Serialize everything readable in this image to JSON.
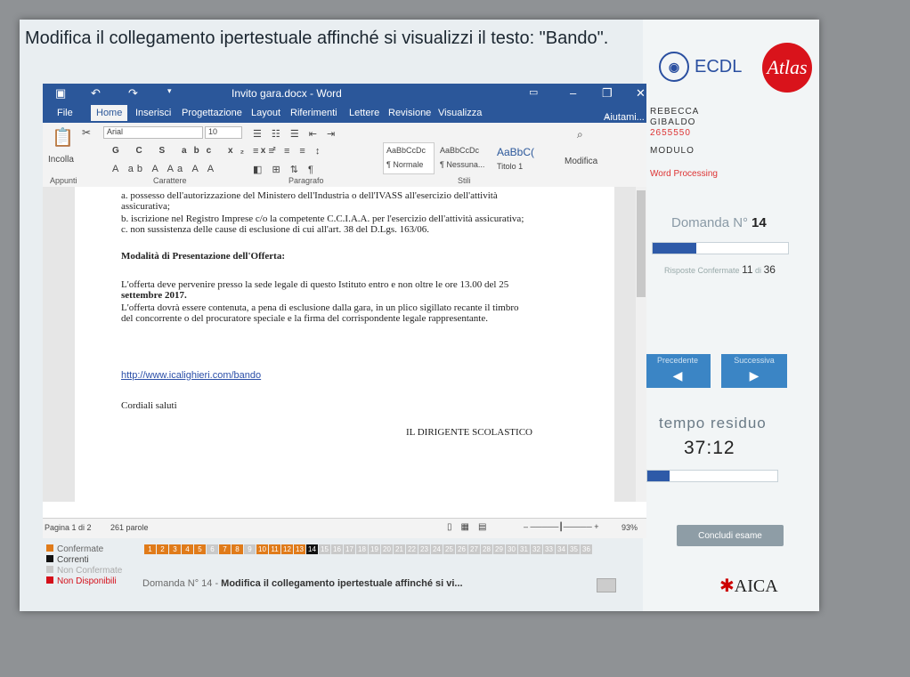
{
  "question_text": "Modifica il collegamento ipertestuale affinché si visualizzi il testo: \"Bando\".",
  "branding": {
    "ecdl": "ECDL",
    "atlas": "Atlas",
    "aica": "AICA"
  },
  "candidate": {
    "name": "REBECCA",
    "surname": "GIBALDO",
    "code": "2655550",
    "module_label": "MODULO",
    "module": "Word Processing"
  },
  "domanda": {
    "label": "Domanda N°",
    "number": "14",
    "progress": 0.32
  },
  "risposte": {
    "label": "Risposte Confermate",
    "count": "11",
    "of": "di",
    "total": "36"
  },
  "nav": {
    "prev": "Precedente",
    "next": "Successiva"
  },
  "timer": {
    "label": "tempo residuo",
    "value": "37:12",
    "progress": 0.17
  },
  "conclude": "Concludi esame",
  "word": {
    "title": "Invito gara.docx - Word",
    "menu": [
      "File",
      "Home",
      "Inserisci",
      "Progettazione",
      "Layout",
      "Riferimenti",
      "Lettere",
      "Revisione",
      "Visualizza"
    ],
    "help": "Aiutami...",
    "font": "Arial",
    "size": "10",
    "paste": "Incolla",
    "groups": [
      "Appunti",
      "Carattere",
      "Paragrafo",
      "Stili"
    ],
    "styles": [
      {
        "preview": "AaBbCcDc",
        "name": "¶ Normale"
      },
      {
        "preview": "AaBbCcDc",
        "name": "¶ Nessuna..."
      },
      {
        "preview": "AaBbC(",
        "name": "Titolo 1"
      }
    ],
    "modify": "Modifica",
    "status": {
      "page": "Pagina 1 di 2",
      "words": "261 parole",
      "zoom": "93%"
    }
  },
  "doc": {
    "lines": [
      "a. possesso dell'autorizzazione del Ministero dell'Industria o dell'IVASS all'esercizio dell'attività",
      "assicurativa;",
      "b. iscrizione nel Registro Imprese c/o la competente C.C.I.A.A. per l'esercizio dell'attività assicurativa;",
      "c. non sussistenza delle cause di esclusione di cui all'art. 38 del D.Lgs. 163/06."
    ],
    "heading": "Modalità di Presentazione dell'Offerta:",
    "offer1": "L'offerta deve pervenire presso la sede legale di questo Istituto entro e non oltre le ore 13.00 del 25",
    "offer1b": "settembre 2017.",
    "offer2": "L'offerta dovrà essere contenuta, a pena di esclusione dalla gara, in un plico sigillato recante il timbro",
    "offer3": "del concorrente o del procuratore speciale e la firma del corrispondente legale rappresentante.",
    "link": "http://www.icalighieri.com/bando",
    "greeting": "Cordiali saluti",
    "signature": "IL DIRIGENTE SCOLASTICO"
  },
  "legend": {
    "confirmed": "Confermate",
    "current": "Correnti",
    "not_confirmed": "Non Confermate",
    "unavailable": "Non Disponibili"
  },
  "footer_question": {
    "label": "Domanda N° 14 -",
    "text": "Modifica il collegamento ipertestuale affinché si vi..."
  },
  "colors": {
    "confirmed": "#e07b1a",
    "current": "#111111",
    "not_confirmed": "#c9c9c9",
    "unavailable": "#d40f1a",
    "word_blue": "#2b579a"
  }
}
